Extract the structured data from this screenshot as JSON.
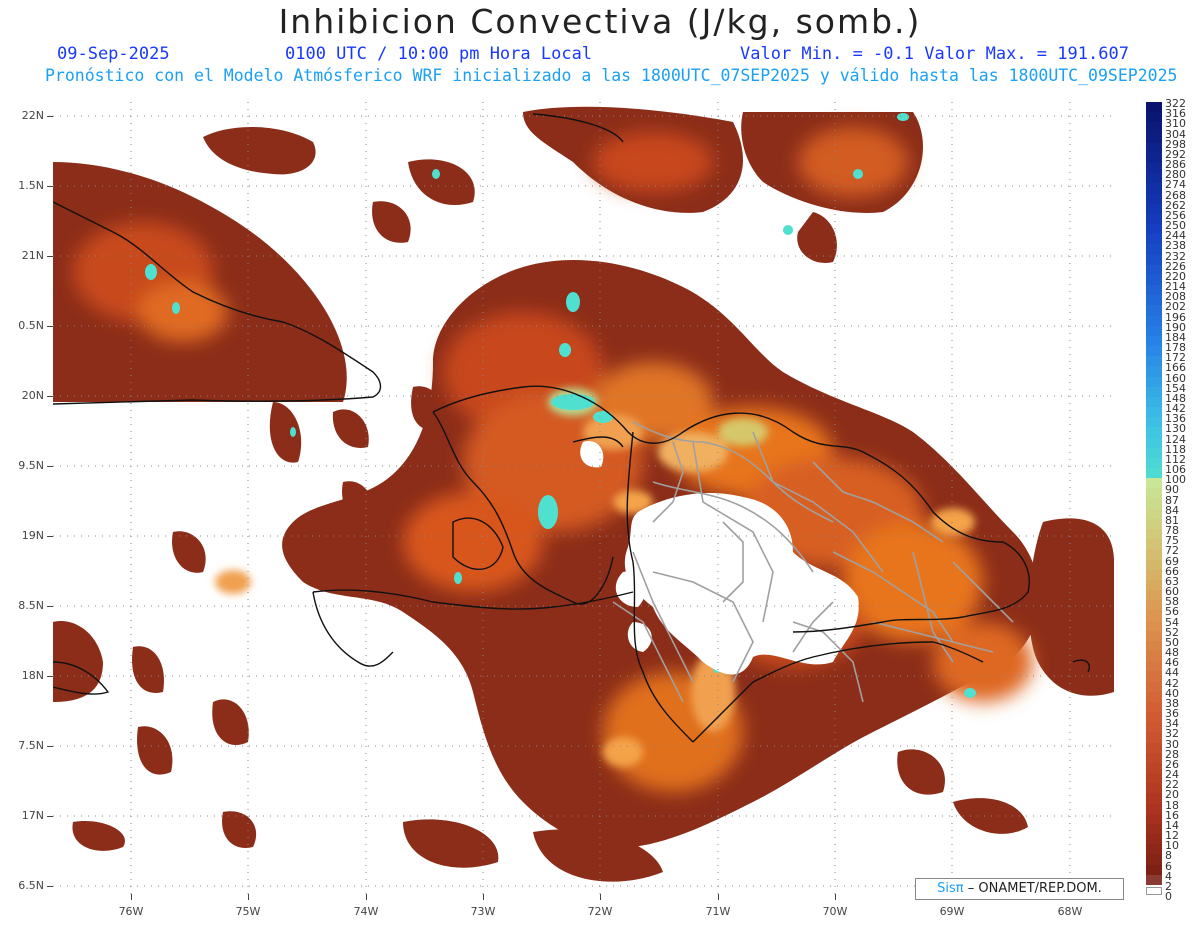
{
  "header": {
    "title": "Inhibicion Convectiva (J/kg, somb.)",
    "date": "09-Sep-2025",
    "time": "0100 UTC / 10:00 pm Hora Local",
    "minmax": "Valor Min. = -0.1  Valor Max. = 191.607",
    "model_info": "Pronóstico con el Modelo Atmósferico WRF inicializado a las 1800UTC_07SEP2025 y válido hasta las  1800UTC_09SEP2025"
  },
  "map": {
    "lat_labels": [
      "22N",
      "1.5N",
      "21N",
      "0.5N",
      "20N",
      "9.5N",
      "19N",
      "8.5N",
      "18N",
      "7.5N",
      "17N",
      "6.5N"
    ],
    "lon_labels": [
      "76W",
      "75W",
      "74W",
      "73W",
      "72W",
      "71W",
      "70W",
      "69W",
      "68W"
    ],
    "colors": {
      "land_high": "#8a2a18",
      "field_mid": "#c8461d",
      "field_warm": "#e8741f",
      "field_peak": "#f4a34a",
      "field_green": "#b3d98c",
      "field_cyan": "#4fe0cf",
      "coast": "#111111",
      "provinces": "#9a9a9a"
    }
  },
  "colorbar": {
    "labels": [
      "322",
      "316",
      "310",
      "304",
      "298",
      "292",
      "286",
      "280",
      "274",
      "268",
      "262",
      "256",
      "250",
      "244",
      "238",
      "232",
      "226",
      "220",
      "214",
      "208",
      "202",
      "196",
      "190",
      "184",
      "178",
      "172",
      "166",
      "160",
      "154",
      "148",
      "142",
      "136",
      "130",
      "124",
      "118",
      "112",
      "106",
      "100",
      "90",
      "87",
      "84",
      "81",
      "78",
      "75",
      "72",
      "69",
      "66",
      "63",
      "60",
      "58",
      "56",
      "54",
      "52",
      "50",
      "48",
      "46",
      "44",
      "42",
      "40",
      "38",
      "36",
      "34",
      "32",
      "30",
      "28",
      "26",
      "24",
      "22",
      "20",
      "18",
      "16",
      "14",
      "12",
      "10",
      "8",
      "6",
      "4",
      "2",
      "0"
    ]
  },
  "credit": {
    "logo": "Sisπ",
    "text": "– ONAMET/REP.DOM."
  }
}
